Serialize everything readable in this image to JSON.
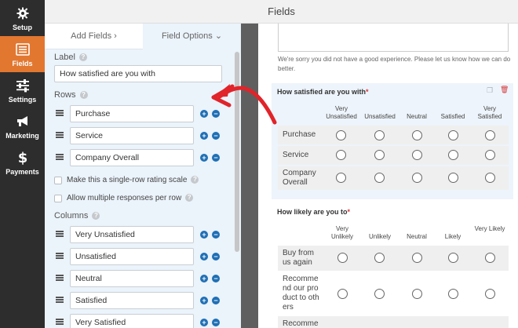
{
  "sidebar": {
    "items": [
      {
        "label": "Setup",
        "icon": "gear-icon"
      },
      {
        "label": "Fields",
        "icon": "list-icon",
        "active": true
      },
      {
        "label": "Settings",
        "icon": "sliders-icon"
      },
      {
        "label": "Marketing",
        "icon": "megaphone-icon"
      },
      {
        "label": "Payments",
        "icon": "dollar-icon"
      }
    ]
  },
  "header": {
    "title": "Fields"
  },
  "panel": {
    "tabs": {
      "add_fields": "Add Fields  ›",
      "field_options": "Field Options  ⌄"
    },
    "label_heading": "Label",
    "label_value": "How satisfied are you with",
    "rows_heading": "Rows",
    "rows": [
      "Purchase",
      "Service",
      "Company Overall"
    ],
    "single_row": "Make this a single-row rating scale",
    "multiple": "Allow multiple responses per row",
    "columns_heading": "Columns",
    "columns": [
      "Very Unsatisfied",
      "Unsatisfied",
      "Neutral",
      "Satisfied",
      "Very Satisfied"
    ]
  },
  "preview": {
    "sorry_text": "We're sorry you did not have a good experience. Please let us know how we can do better.",
    "field1": {
      "title": "How satisfied are you with",
      "required": "*",
      "columns": [
        "Very Unsatisfied",
        "Unsatisfied",
        "Neutral",
        "Satisfied",
        "Very Satisfied"
      ],
      "rows": [
        "Purchase",
        "Service",
        "Company Overall"
      ]
    },
    "field2": {
      "title": "How likely are you to",
      "required": "*",
      "columns": [
        "Very Unlikely",
        "Unlikely",
        "Neutral",
        "Likely",
        "Very Likely"
      ],
      "rows": [
        "Buy from us again",
        "Recommend our product to others",
        "Recomme"
      ]
    }
  },
  "colors": {
    "accent": "#e27730",
    "sidebar": "#2d2d2d",
    "arrow": "#e0242a",
    "blue": "#1f6fb5"
  }
}
